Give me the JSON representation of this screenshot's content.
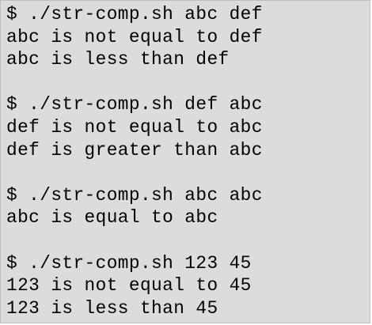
{
  "terminal": {
    "sessions": [
      {
        "command": "$ ./str-comp.sh abc def",
        "output": [
          "abc is not equal to def",
          "abc is less than def"
        ]
      },
      {
        "command": "$ ./str-comp.sh def abc",
        "output": [
          "def is not equal to abc",
          "def is greater than abc"
        ]
      },
      {
        "command": "$ ./str-comp.sh abc abc",
        "output": [
          "abc is equal to abc"
        ]
      },
      {
        "command": "$ ./str-comp.sh 123 45",
        "output": [
          "123 is not equal to 45",
          "123 is less than 45"
        ]
      }
    ],
    "colors": {
      "background": "#dcdcdc",
      "text": "#000000"
    }
  }
}
